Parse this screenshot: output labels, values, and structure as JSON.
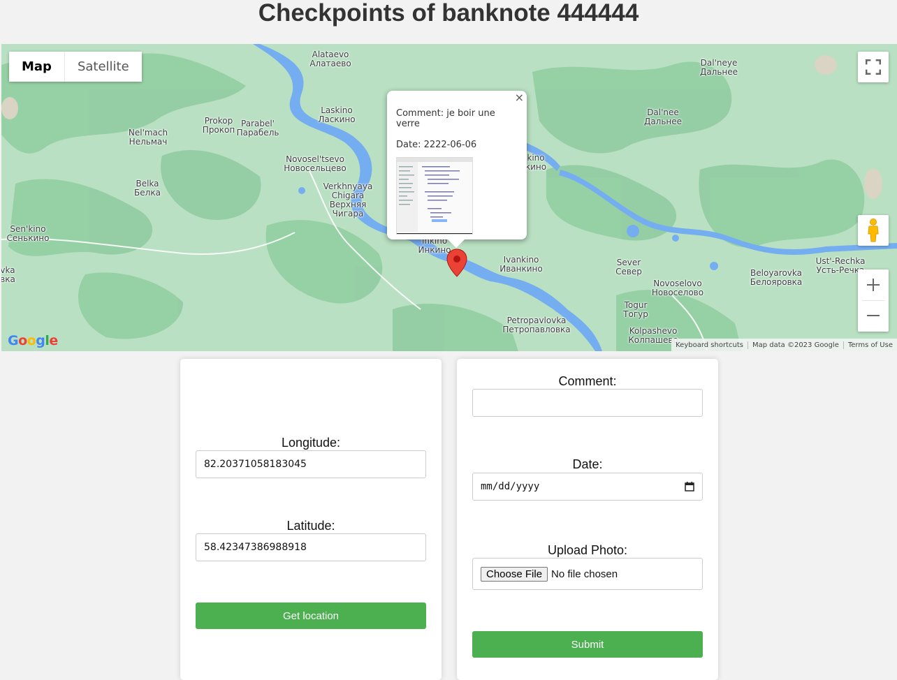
{
  "page": {
    "title": "Checkpoints of banknote 444444"
  },
  "map": {
    "type_tabs": [
      "Map",
      "Satellite"
    ],
    "active_tab": "Map",
    "places": [
      {
        "lat": "Alataevo",
        "cyr": "Алатаево"
      },
      {
        "lat": "Dal'neye",
        "cyr": "Дальнее"
      },
      {
        "lat": "Laskino",
        "cyr": "Ласкино"
      },
      {
        "lat": "Prokop",
        "cyr": "Прокоп"
      },
      {
        "lat": "Parabel'",
        "cyr": "Парабель"
      },
      {
        "lat": "Nel'mach",
        "cyr": "Нельмач"
      },
      {
        "lat": "Dal'nee",
        "cyr": "Дальнее"
      },
      {
        "lat": "Novosel'tsevo",
        "cyr": "Новосельцево"
      },
      {
        "lat": "Belka",
        "cyr": "Белка"
      },
      {
        "lat": "Verkhnyaya Chigara",
        "cyr": "Верхняя Чигара"
      },
      {
        "lat": "Sen'kino",
        "cyr": "Сенькино"
      },
      {
        "lat": "Inkino",
        "cyr": "Инкино"
      },
      {
        "lat": "Ivankino",
        "cyr": "Иванкино"
      },
      {
        "lat": "Sever",
        "cyr": "Север"
      },
      {
        "lat": "Novoselovo",
        "cyr": "Новоселово"
      },
      {
        "lat": "Beloyarovka",
        "cyr": "Белояровка"
      },
      {
        "lat": "Ust'-Rechka",
        "cyr": "Усть-Речка"
      },
      {
        "lat": "Togur",
        "cyr": "Тогур"
      },
      {
        "lat": "Petropavlovka",
        "cyr": "Петропавловка"
      },
      {
        "lat": "Kolpashevo",
        "cyr": "Колпашево"
      },
      {
        "lat": "kino",
        "cyr": "кино"
      },
      {
        "lat": "vka",
        "cyr": "вка"
      }
    ],
    "infowindow": {
      "comment": "Comment: je boir une verre",
      "date": "Date: 2222-06-06",
      "close_glyph": "×"
    },
    "logo": "Google",
    "attribution": [
      "Keyboard shortcuts",
      "Map data ©2023 Google",
      "Terms of Use"
    ],
    "colors": {
      "land": "#b9e0c2",
      "forest": "#8fcca0",
      "water": "#75aef0",
      "road": "#ffffff",
      "marker": "#ea4335"
    }
  },
  "location_form": {
    "longitude_label": "Longitude:",
    "longitude_value": "82.20371058183045",
    "latitude_label": "Latitude:",
    "latitude_value": "58.42347386988918",
    "get_location_label": "Get location"
  },
  "checkpoint_form": {
    "comment_label": "Comment:",
    "comment_value": "",
    "date_label": "Date:",
    "date_placeholder": "mm/dd/yyyy",
    "photo_label": "Upload Photo:",
    "choose_file_label": "Choose File",
    "no_file_label": "No file chosen",
    "submit_label": "Submit"
  }
}
